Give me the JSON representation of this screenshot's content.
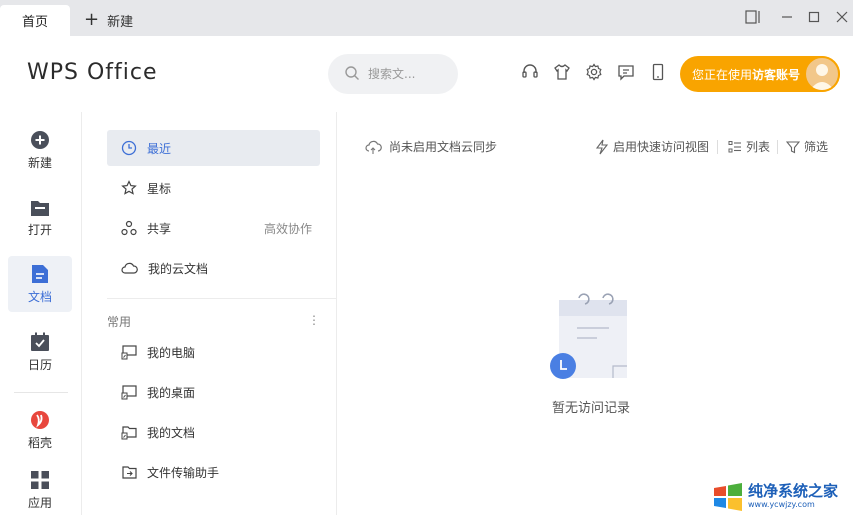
{
  "titlebar": {
    "home_tab": "首页",
    "new_tab": "新建"
  },
  "header": {
    "logo": "WPS Office",
    "search_placeholder": "搜索文...",
    "account_prefix": "您正在使用",
    "account_name": "访客账号"
  },
  "leftnav": {
    "items": [
      {
        "label": "新建",
        "icon": "plus-circle-icon"
      },
      {
        "label": "打开",
        "icon": "folder-icon"
      },
      {
        "label": "文档",
        "icon": "document-icon"
      },
      {
        "label": "日历",
        "icon": "calendar-icon"
      },
      {
        "label": "稻壳",
        "icon": "docer-icon"
      },
      {
        "label": "应用",
        "icon": "apps-grid-icon"
      }
    ]
  },
  "midpanel": {
    "items": [
      {
        "label": "最近",
        "icon": "clock-icon"
      },
      {
        "label": "星标",
        "icon": "star-icon"
      },
      {
        "label": "共享",
        "icon": "share-icon",
        "aux": "高效协作"
      },
      {
        "label": "我的云文档",
        "icon": "cloud-icon"
      }
    ],
    "section_title": "常用",
    "common_items": [
      {
        "label": "我的电脑",
        "icon": "computer-shortcut-icon"
      },
      {
        "label": "我的桌面",
        "icon": "desktop-shortcut-icon"
      },
      {
        "label": "我的文档",
        "icon": "folder-shortcut-icon"
      },
      {
        "label": "文件传输助手",
        "icon": "transfer-icon"
      }
    ]
  },
  "content": {
    "sync_status": "尚未启用文档云同步",
    "quick_view": "启用快速访问视图",
    "list_view": "列表",
    "filter": "筛选",
    "empty_text": "暂无访问记录"
  },
  "watermark": {
    "main": "纯净系统之家",
    "url": "www.ycwjzy.com"
  },
  "colors": {
    "accent": "#3d6fd6",
    "account_bg": "#f9a400",
    "titlebar_bg": "#e6e7ea"
  }
}
